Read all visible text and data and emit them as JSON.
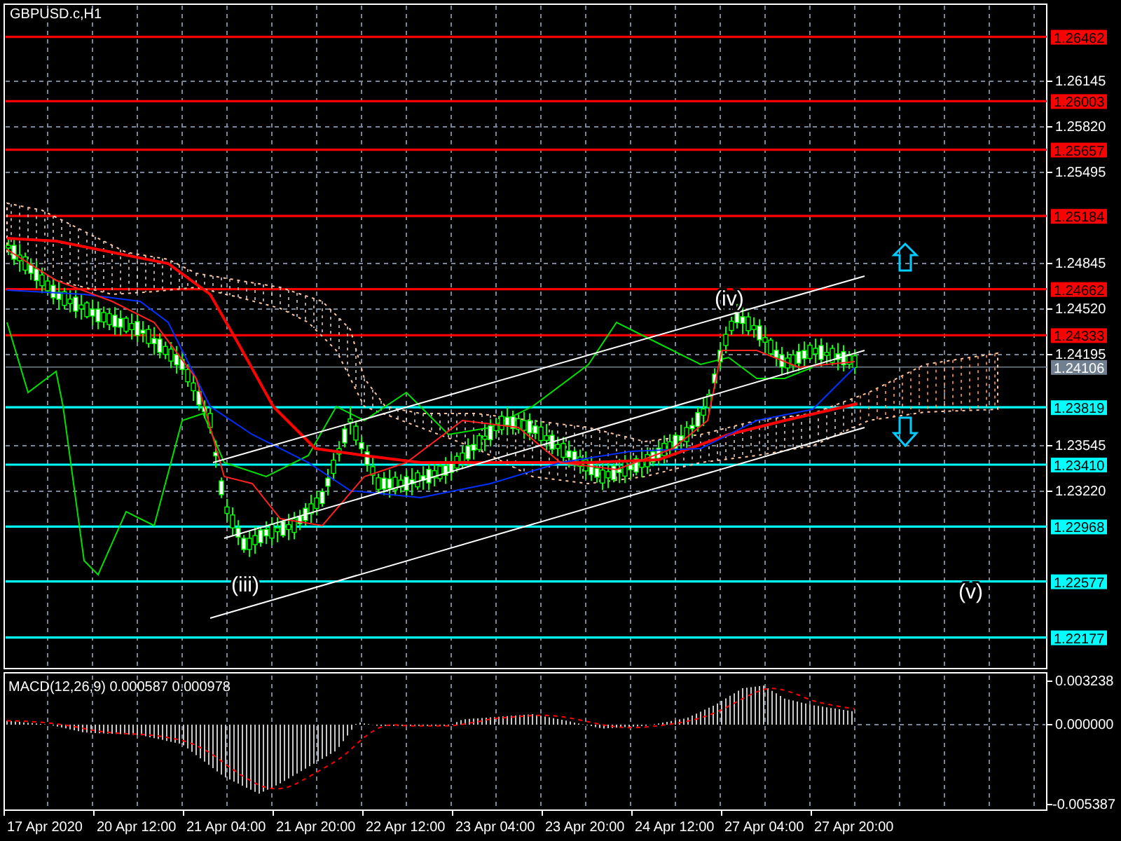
{
  "chart": {
    "title": "GBPUSD.c,H1",
    "price_ticks": [
      "1.26145",
      "1.25820",
      "1.25495",
      "1.24845",
      "1.24520",
      "1.24195",
      "1.23545",
      "1.23220"
    ],
    "levels": [
      {
        "label": "1.26462",
        "color": "#ff0000",
        "kind": "line"
      },
      {
        "label": "1.26003",
        "color": "#ff0000",
        "kind": "line"
      },
      {
        "label": "1.25657",
        "color": "#ff0000",
        "kind": "line"
      },
      {
        "label": "1.25184",
        "color": "#ff0000",
        "kind": "line"
      },
      {
        "label": "1.24662",
        "color": "#ff0000",
        "kind": "line"
      },
      {
        "label": "1.24333",
        "color": "#ff0000",
        "kind": "line"
      },
      {
        "label": "1.24106",
        "color": "#708090",
        "kind": "current"
      },
      {
        "label": "1.23819",
        "color": "#00ffff",
        "kind": "line"
      },
      {
        "label": "1.23410",
        "color": "#00ffff",
        "kind": "line"
      },
      {
        "label": "1.22968",
        "color": "#00ffff",
        "kind": "line"
      },
      {
        "label": "1.22577",
        "color": "#00ffff",
        "kind": "line"
      },
      {
        "label": "1.22177",
        "color": "#00ffff",
        "kind": "line"
      }
    ],
    "wave_labels": [
      "(iii)",
      "(iv)",
      "(v)"
    ]
  },
  "macd": {
    "title": "MACD(12,26,9) 0.000587 0.000978",
    "scale_labels": [
      "0.003238",
      "0.000000",
      "-0.005387"
    ]
  },
  "time_axis": [
    "17 Apr 2020",
    "20 Apr 12:00",
    "21 Apr 04:00",
    "21 Apr 20:00",
    "22 Apr 12:00",
    "23 Apr 04:00",
    "23 Apr 20:00",
    "24 Apr 12:00",
    "27 Apr 04:00",
    "27 Apr 20:00"
  ]
}
